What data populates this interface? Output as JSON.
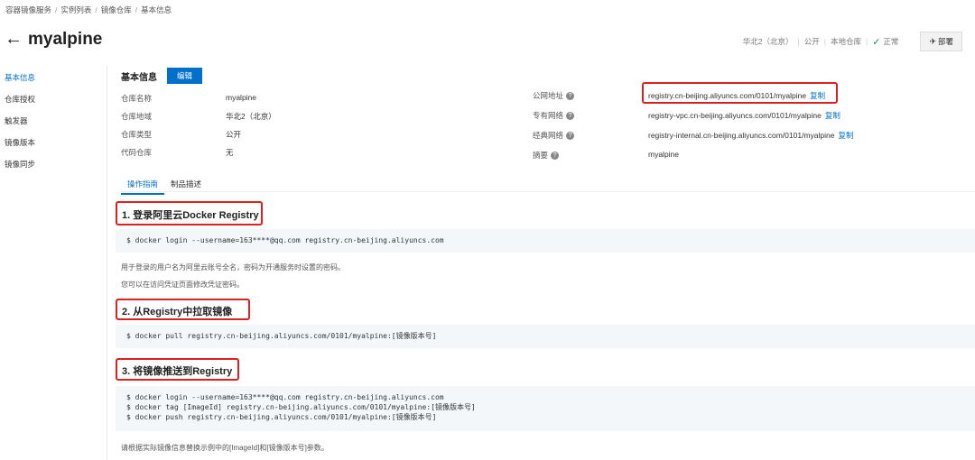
{
  "breadcrumb": [
    "容器镜像服务",
    "实例列表",
    "镜像仓库",
    "基本信息"
  ],
  "header": {
    "title": "myalpine",
    "region": "华北2（北京）",
    "visibility": "公开",
    "repo_type": "本地仓库",
    "status": "正常",
    "deploy_label": "部署"
  },
  "sidebar": {
    "items": [
      {
        "label": "基本信息",
        "active": true
      },
      {
        "label": "仓库授权"
      },
      {
        "label": "触发器"
      },
      {
        "label": "镜像版本"
      },
      {
        "label": "镜像同步"
      }
    ]
  },
  "basic_info": {
    "title": "基本信息",
    "edit_label": "编辑",
    "left": [
      {
        "label": "仓库名称",
        "value": "myalpine"
      },
      {
        "label": "仓库地域",
        "value": "华北2（北京）"
      },
      {
        "label": "仓库类型",
        "value": "公开"
      },
      {
        "label": "代码仓库",
        "value": "无"
      }
    ],
    "right": [
      {
        "label": "公网地址",
        "value": "registry.cn-beijing.aliyuncs.com/0101/myalpine",
        "copy": "复制"
      },
      {
        "label": "专有网络",
        "value": "registry-vpc.cn-beijing.aliyuncs.com/0101/myalpine",
        "copy": "复制"
      },
      {
        "label": "经典网络",
        "value": "registry-internal.cn-beijing.aliyuncs.com/0101/myalpine",
        "copy": "复制"
      },
      {
        "label": "摘要",
        "value": "myalpine"
      }
    ]
  },
  "tabs": [
    {
      "label": "操作指南",
      "active": true
    },
    {
      "label": "制品描述"
    }
  ],
  "guide": {
    "step1": {
      "title": "1. 登录阿里云Docker Registry",
      "code": [
        "$ docker login --username=163****@qq.com registry.cn-beijing.aliyuncs.com"
      ],
      "notes": [
        "用于登录的用户名为阿里云账号全名，密码为开通服务时设置的密码。",
        "您可以在访问凭证页面修改凭证密码。"
      ]
    },
    "step2": {
      "title": "2. 从Registry中拉取镜像",
      "code": [
        "$ docker pull registry.cn-beijing.aliyuncs.com/0101/myalpine:[镜像版本号]"
      ]
    },
    "step3": {
      "title": "3. 将镜像推送到Registry",
      "code": [
        "$ docker login --username=163****@qq.com registry.cn-beijing.aliyuncs.com",
        "$ docker tag [ImageId] registry.cn-beijing.aliyuncs.com/0101/myalpine:[镜像版本号]",
        "$ docker push registry.cn-beijing.aliyuncs.com/0101/myalpine:[镜像版本号]"
      ],
      "notes": [
        "请根据实际镜像信息替换示例中的[ImageId]和[镜像版本号]参数。"
      ]
    }
  },
  "colors": {
    "accent": "#0070cc",
    "highlight": "#e02020",
    "success": "#1e8e3e"
  }
}
